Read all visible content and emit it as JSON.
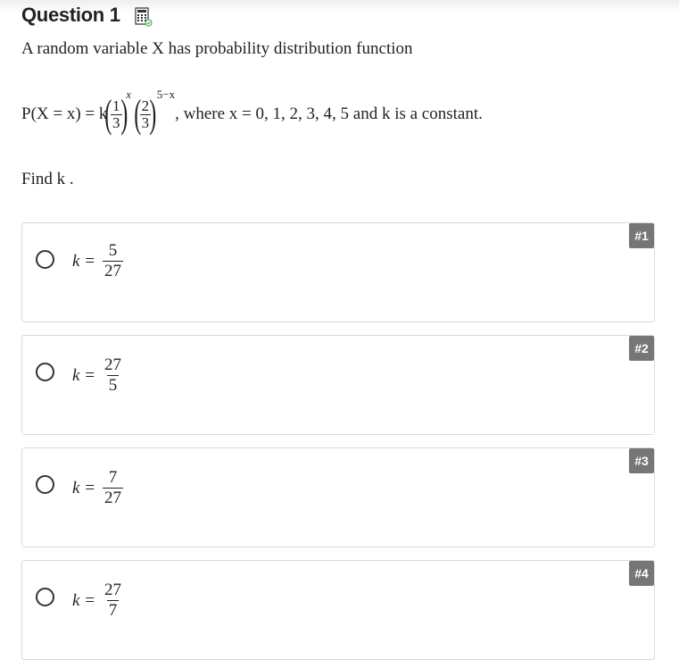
{
  "question": {
    "title": "Question 1",
    "intro": "A random variable X has probability distribution function",
    "formula": {
      "lhs": "P(X = x) = k",
      "frac1_num": "1",
      "frac1_den": "3",
      "exp1": "x",
      "frac2_num": "2",
      "frac2_den": "3",
      "exp2": "5−x",
      "tail": ", where x = 0, 1, 2, 3, 4, 5 and k is a constant."
    },
    "prompt": "Find k ."
  },
  "options": [
    {
      "badge": "#1",
      "lhs": "k =",
      "num": "5",
      "den": "27"
    },
    {
      "badge": "#2",
      "lhs": "k =",
      "num": "27",
      "den": "5"
    },
    {
      "badge": "#3",
      "lhs": "k =",
      "num": "7",
      "den": "27"
    },
    {
      "badge": "#4",
      "lhs": "k =",
      "num": "27",
      "den": "7"
    }
  ],
  "icons": {
    "calculator": "calculator-icon"
  },
  "colors": {
    "badge_bg": "#767676",
    "border": "#d9d9d9",
    "calculator_check": "#2eaa3c"
  }
}
